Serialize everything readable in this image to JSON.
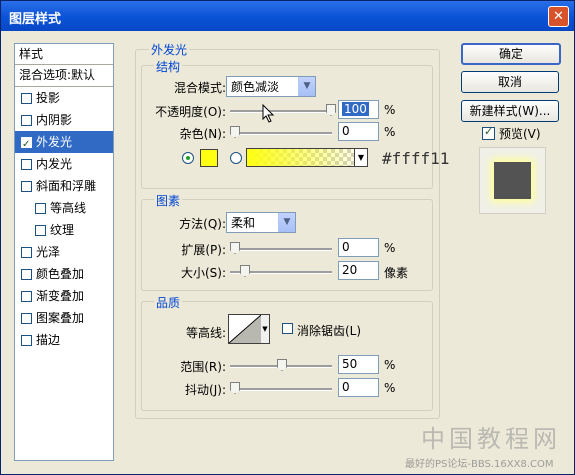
{
  "window": {
    "title": "图层样式",
    "close_icon": "✕"
  },
  "style_list": {
    "header": "样式",
    "blend_options": "混合选项:默认",
    "items": [
      {
        "label": "投影",
        "checked": false,
        "indent": false,
        "selected": false
      },
      {
        "label": "内阴影",
        "checked": false,
        "indent": false,
        "selected": false
      },
      {
        "label": "外发光",
        "checked": true,
        "indent": false,
        "selected": true
      },
      {
        "label": "内发光",
        "checked": false,
        "indent": false,
        "selected": false
      },
      {
        "label": "斜面和浮雕",
        "checked": false,
        "indent": false,
        "selected": false
      },
      {
        "label": "等高线",
        "checked": false,
        "indent": true,
        "selected": false
      },
      {
        "label": "纹理",
        "checked": false,
        "indent": true,
        "selected": false
      },
      {
        "label": "光泽",
        "checked": false,
        "indent": false,
        "selected": false
      },
      {
        "label": "颜色叠加",
        "checked": false,
        "indent": false,
        "selected": false
      },
      {
        "label": "渐变叠加",
        "checked": false,
        "indent": false,
        "selected": false
      },
      {
        "label": "图案叠加",
        "checked": false,
        "indent": false,
        "selected": false
      },
      {
        "label": "描边",
        "checked": false,
        "indent": false,
        "selected": false
      }
    ]
  },
  "outer_glow": {
    "title": "外发光",
    "structure": {
      "title": "结构",
      "blend_mode_label": "混合模式:",
      "blend_mode_value": "颜色减淡",
      "opacity_label": "不透明度(O):",
      "opacity_value": "100",
      "opacity_unit": "%",
      "noise_label": "杂色(N):",
      "noise_value": "0",
      "noise_unit": "%",
      "color_hex": "#ffff11",
      "color_swatch": "#ffff11"
    },
    "elements": {
      "title": "图素",
      "technique_label": "方法(Q):",
      "technique_value": "柔和",
      "spread_label": "扩展(P):",
      "spread_value": "0",
      "spread_unit": "%",
      "size_label": "大小(S):",
      "size_value": "20",
      "size_unit": "像素"
    },
    "quality": {
      "title": "品质",
      "contour_label": "等高线:",
      "anti_alias_label": "消除锯齿(L)",
      "range_label": "范围(R):",
      "range_value": "50",
      "range_unit": "%",
      "jitter_label": "抖动(J):",
      "jitter_value": "0",
      "jitter_unit": "%"
    }
  },
  "buttons": {
    "ok": "确定",
    "cancel": "取消",
    "new_style": "新建样式(W)...",
    "preview": "预览(V)"
  },
  "watermark": {
    "main": "中国教程网",
    "sub": "最好的PS论坛-BBS.16XX8.COM"
  }
}
